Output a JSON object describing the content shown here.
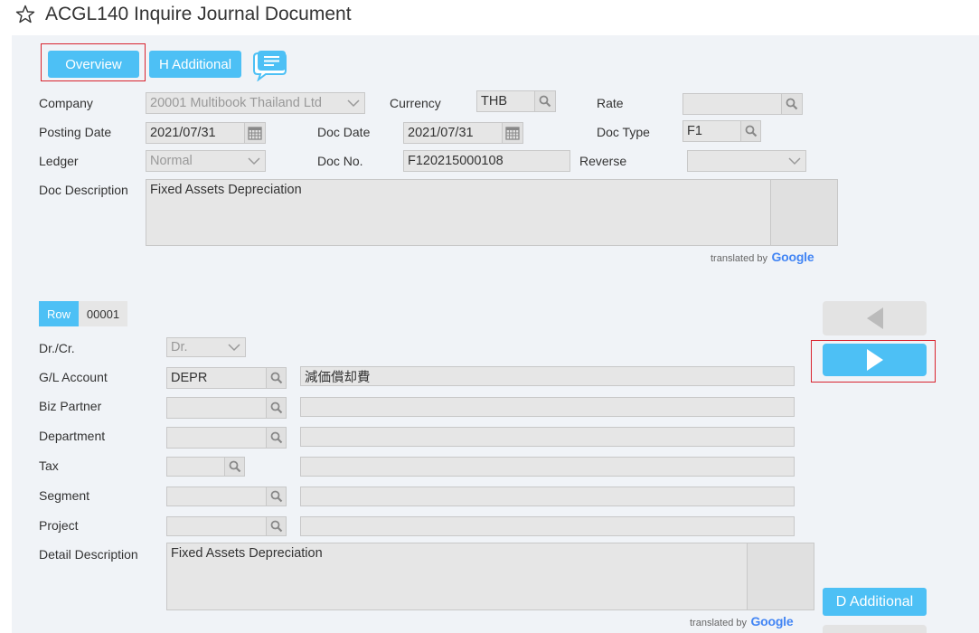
{
  "page": {
    "title": "ACGL140 Inquire Journal Document"
  },
  "header": {
    "buttons": {
      "overview": "Overview",
      "h_additional": "H Additional"
    },
    "company": {
      "label": "Company",
      "value": "20001 Multibook Thailand Ltd"
    },
    "currency": {
      "label": "Currency",
      "value": "THB"
    },
    "rate": {
      "label": "Rate",
      "value": ""
    },
    "posting_date": {
      "label": "Posting Date",
      "value": "2021/07/31"
    },
    "doc_date": {
      "label": "Doc Date",
      "value": "2021/07/31"
    },
    "doc_type": {
      "label": "Doc Type",
      "value": "F1"
    },
    "ledger": {
      "label": "Ledger",
      "value": "Normal"
    },
    "doc_no": {
      "label": "Doc No.",
      "value": "F120215000108"
    },
    "reverse": {
      "label": "Reverse",
      "value": ""
    },
    "doc_description": {
      "label": "Doc Description",
      "value": "Fixed Assets Depreciation"
    },
    "translated_by": "translated by",
    "google": "Google"
  },
  "detail": {
    "row_label": "Row",
    "row_number": "00001",
    "drcr": {
      "label": "Dr./Cr.",
      "value": "Dr."
    },
    "gl_account": {
      "label": "G/L Account",
      "code": "DEPR",
      "name": "減価償却費"
    },
    "biz_partner": {
      "label": "Biz Partner",
      "code": "",
      "name": ""
    },
    "department": {
      "label": "Department",
      "code": "",
      "name": ""
    },
    "tax": {
      "label": "Tax",
      "code": "",
      "name": ""
    },
    "segment": {
      "label": "Segment",
      "code": "",
      "name": ""
    },
    "project": {
      "label": "Project",
      "code": "",
      "name": ""
    },
    "detail_description": {
      "label": "Detail Description",
      "value": "Fixed Assets Depreciation"
    },
    "translated_by": "translated by",
    "google": "Google",
    "d_additional": "D Additional"
  },
  "colors": {
    "accent": "#4dc0f5",
    "highlight": "#d9232e",
    "panel": "#f0f3f7",
    "field": "#e6e6e6"
  },
  "icons": {
    "favorite": "star-icon",
    "chat": "chat-icon",
    "search": "search-icon",
    "calendar": "calendar-icon",
    "dropdown": "chevron-down-icon",
    "prev": "triangle-left-icon",
    "next": "triangle-right-icon"
  }
}
